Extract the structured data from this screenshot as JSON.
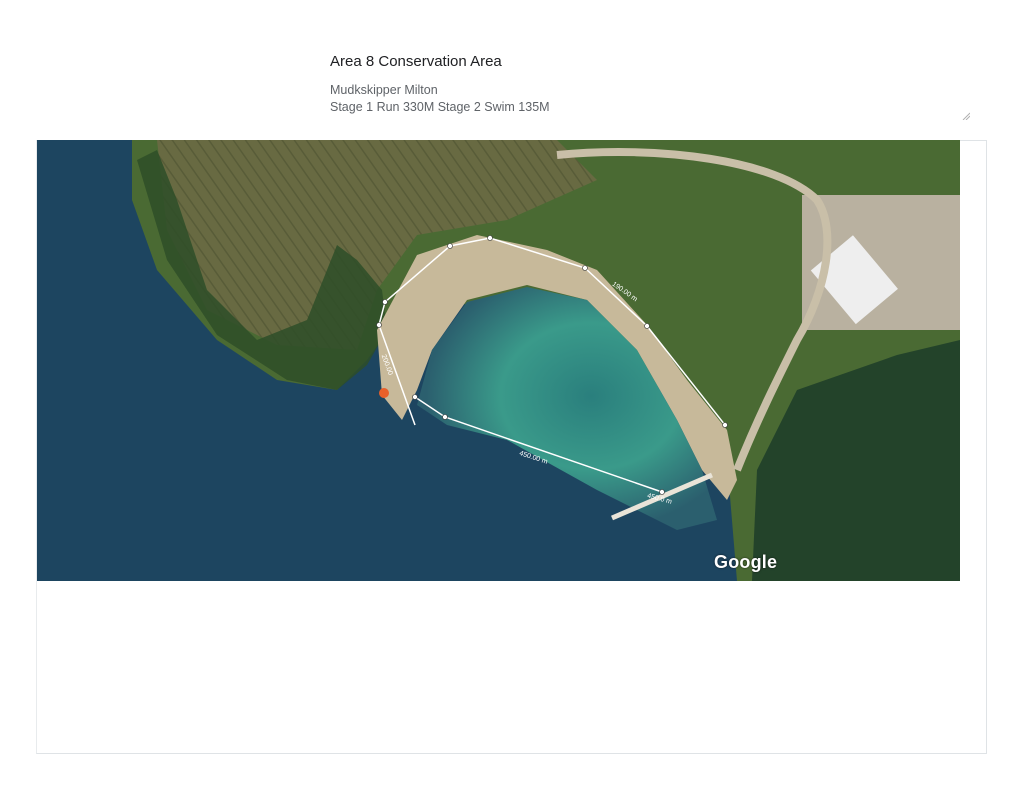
{
  "header": {
    "title": "Area 8 Conservation Area",
    "subtitle": "Mudkskipper Milton",
    "details": "Stage 1 Run 330M Stage 2 Swim 135M"
  },
  "map": {
    "attribution": "Google",
    "measurements": {
      "seg_run_a": "190.00 m",
      "seg_run_b": "200.00",
      "seg_swim": "450.00 m",
      "seg_swim_end": "450.0 m"
    },
    "colors": {
      "water_deep": "#1d4560",
      "water_shallow": "#2f8a86",
      "grass": "#4c6b34",
      "field": "#6d6a45",
      "route": "#ffffff"
    }
  }
}
